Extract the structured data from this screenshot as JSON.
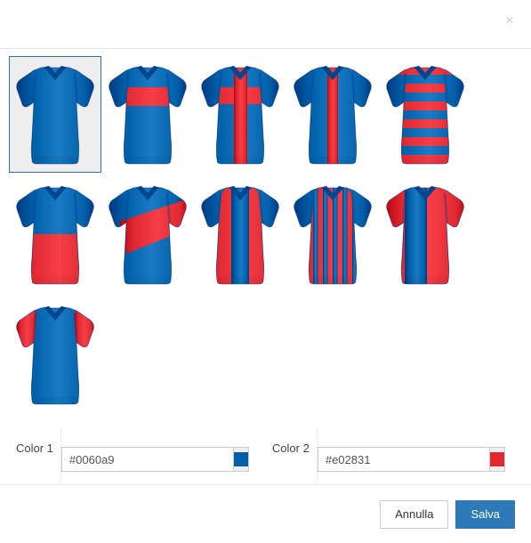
{
  "dialog": {
    "close_label": "×"
  },
  "jerseys": {
    "selected_index": 0,
    "items": [
      {
        "name": "jersey-plain",
        "pattern": "plain"
      },
      {
        "name": "jersey-chest-band",
        "pattern": "chest-band"
      },
      {
        "name": "jersey-cross",
        "pattern": "cross"
      },
      {
        "name": "jersey-center-stripe",
        "pattern": "center-stripe"
      },
      {
        "name": "jersey-hoops",
        "pattern": "hoops"
      },
      {
        "name": "jersey-bottom-half",
        "pattern": "bottom-half"
      },
      {
        "name": "jersey-diagonal-sash",
        "pattern": "diagonal-sash"
      },
      {
        "name": "jersey-three-stripes",
        "pattern": "three-stripes"
      },
      {
        "name": "jersey-thin-stripes",
        "pattern": "thin-stripes"
      },
      {
        "name": "jersey-half-vertical",
        "pattern": "half-vertical"
      },
      {
        "name": "jersey-colored-sleeves",
        "pattern": "colored-sleeves"
      }
    ]
  },
  "colors": {
    "color1": {
      "label": "Color 1",
      "value": "#0060a9",
      "swatch": "#0060a9"
    },
    "color2": {
      "label": "Color 2",
      "value": "#e02831",
      "swatch": "#e02831"
    }
  },
  "footer": {
    "cancel_label": "Annulla",
    "save_label": "Salva"
  }
}
